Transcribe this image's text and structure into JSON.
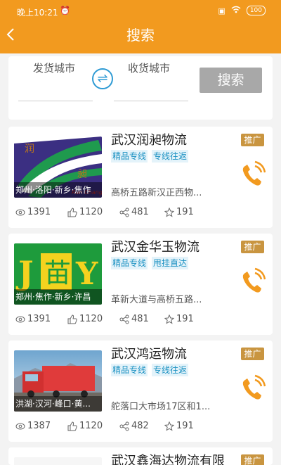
{
  "status_bar": {
    "time": "晚上10:21",
    "battery": "100"
  },
  "header": {
    "title": "搜索"
  },
  "search": {
    "from_label": "发货城市",
    "to_label": "收货城市",
    "button_label": "搜索"
  },
  "colors": {
    "accent": "#f29a1f",
    "tag_blue": "#1b91c2",
    "promo_gold": "#c99540"
  },
  "listings": [
    {
      "name": "武汉润昶物流",
      "tags": [
        "精品专线",
        "专线往返"
      ],
      "promo": "推广",
      "thumb_label": "郑州·洛阳·新乡·焦作",
      "logo_text": "Run Chang",
      "address": "高桥五路新汉正西物...",
      "views": "1391",
      "likes": "1120",
      "shares": "481",
      "favorites": "191"
    },
    {
      "name": "武汉金华玉物流",
      "tags": [
        "精品专线",
        "甩挂直达"
      ],
      "promo": "推广",
      "thumb_label": "郑州·焦作·新乡·许昌",
      "address": "革新大道与高桥五路...",
      "views": "1391",
      "likes": "1120",
      "shares": "481",
      "favorites": "191"
    },
    {
      "name": "武汉鸿运物流",
      "tags": [
        "精品专线",
        "专线往返"
      ],
      "promo": "推广",
      "thumb_label": "洪湖·汉河·峰口·黄...",
      "address": "舵落口大市场17区和1...",
      "views": "1387",
      "likes": "1120",
      "shares": "482",
      "favorites": "191"
    },
    {
      "name": "武汉鑫海达物流有限",
      "promo": "推广"
    }
  ]
}
